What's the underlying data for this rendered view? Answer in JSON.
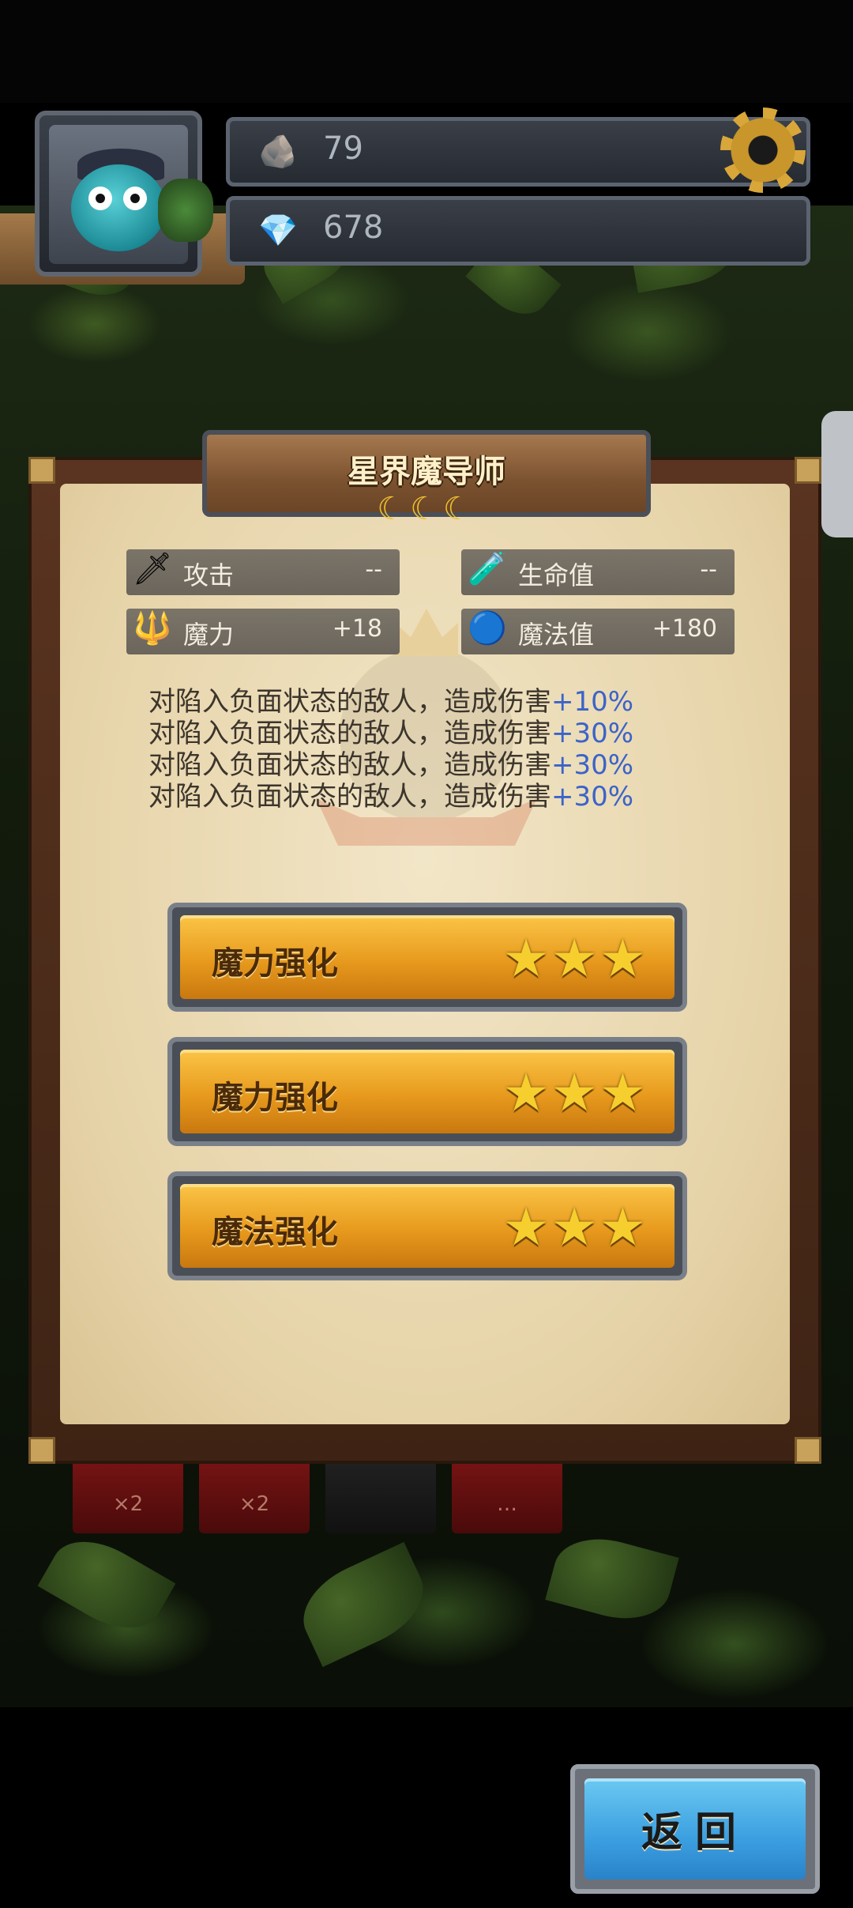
{
  "hud": {
    "resource_1": {
      "icon": "rune-stone-icon",
      "value": "79"
    },
    "resource_2": {
      "icon": "blue-crystal-icon",
      "value": "678"
    }
  },
  "panel": {
    "title": "星界魔导师",
    "rank_marks": "☾☾☾",
    "stats": [
      {
        "icon": "sword-icon",
        "label": "攻击",
        "value": "--"
      },
      {
        "icon": "red-potion-icon",
        "label": "生命值",
        "value": "--"
      },
      {
        "icon": "magic-staff-icon",
        "label": "魔力",
        "value": "+18"
      },
      {
        "icon": "blue-potion-icon",
        "label": "魔法值",
        "value": "+180"
      }
    ],
    "effects": [
      {
        "text": "对陷入负面状态的敌人，造成伤害",
        "bonus": "+10%"
      },
      {
        "text": "对陷入负面状态的敌人，造成伤害",
        "bonus": "+30%"
      },
      {
        "text": "对陷入负面状态的敌人，造成伤害",
        "bonus": "+30%"
      },
      {
        "text": "对陷入负面状态的敌人，造成伤害",
        "bonus": "+30%"
      }
    ],
    "upgrades": [
      {
        "label": "魔力强化",
        "stars": "★★★"
      },
      {
        "label": "魔力强化",
        "stars": "★★★"
      },
      {
        "label": "魔法强化",
        "stars": "★★★"
      }
    ]
  },
  "background_cards": [
    "×2",
    "×2",
    "",
    "…"
  ],
  "back_button": {
    "label": "返回"
  },
  "colors": {
    "highlight": "#3b63c9",
    "button_gold": "#e79a1d",
    "button_blue": "#3b9fe0"
  }
}
